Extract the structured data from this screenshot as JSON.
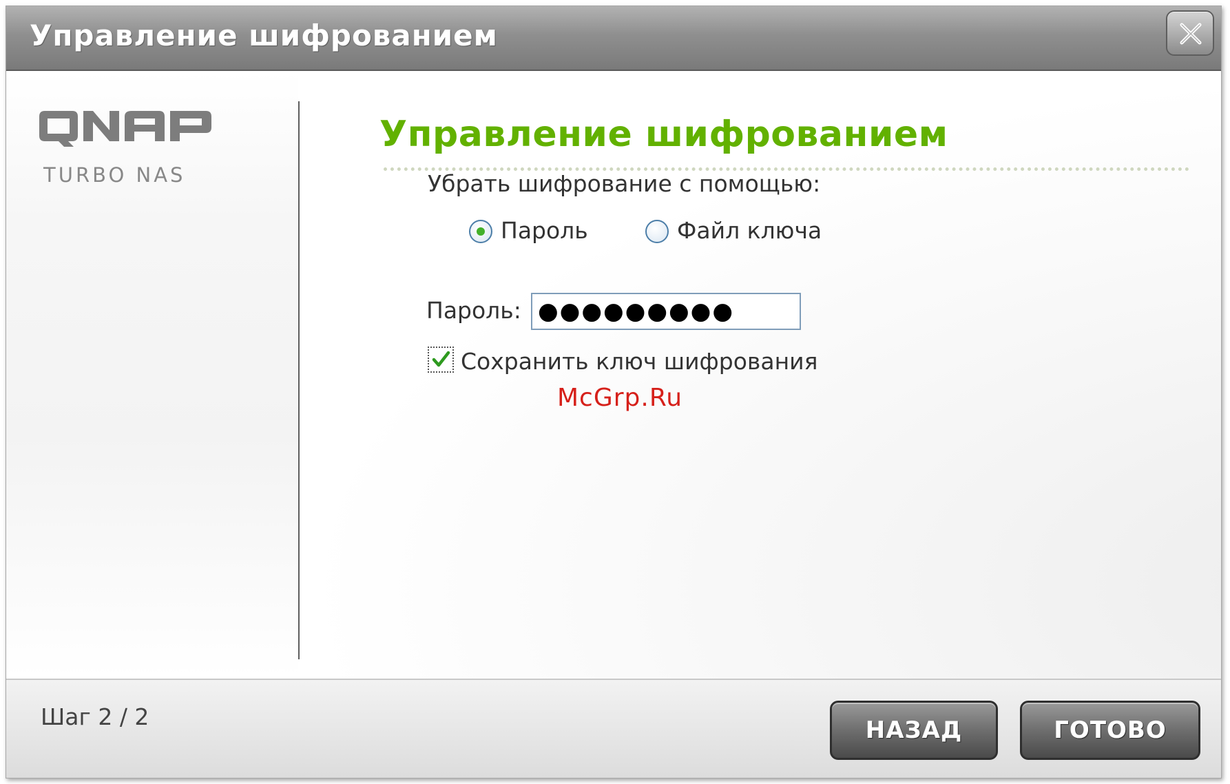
{
  "window": {
    "title": "Управление шифрованием"
  },
  "logo": {
    "brand": "QNAP",
    "subtitle": "TURBO NAS"
  },
  "main": {
    "heading": "Управление шифрованием",
    "remove_label": "Убрать шифрование с помощью:",
    "options": [
      {
        "label": "Пароль",
        "selected": true
      },
      {
        "label": "Файл ключа",
        "selected": false
      }
    ],
    "password_label": "Пароль:",
    "password_value": "●●●●●●●●●",
    "save_key_label": "Сохранить ключ шифрования",
    "save_key_checked": true
  },
  "watermark": "McGrp.Ru",
  "footer": {
    "step": "Шаг 2 / 2",
    "back_label": "НАЗАД",
    "done_label": "ГОТОВО"
  },
  "colors": {
    "heading_green": "#62b100",
    "titlebar_gray": "#8f8f8f",
    "watermark_red": "#d6201a"
  }
}
